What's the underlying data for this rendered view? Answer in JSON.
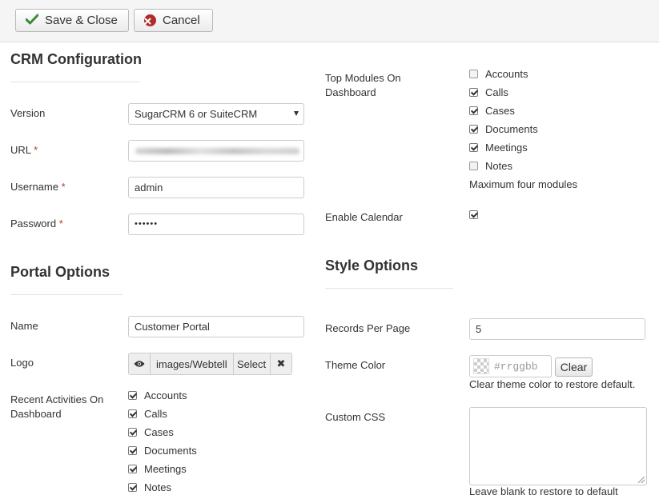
{
  "toolbar": {
    "save_close_label": "Save & Close",
    "cancel_label": "Cancel"
  },
  "crm": {
    "heading": "CRM Configuration",
    "version_label": "Version",
    "version_value": "SugarCRM 6 or SuiteCRM",
    "url_label": "URL",
    "username_label": "Username",
    "username_value": "admin",
    "password_label": "Password",
    "password_value": "••••••",
    "required_mark": "*"
  },
  "portal": {
    "heading": "Portal Options",
    "name_label": "Name",
    "name_value": "Customer Portal",
    "logo_label": "Logo",
    "logo_value": "images/Webtell",
    "logo_select_label": "Select",
    "logo_clear_label": "✖",
    "recent_label": "Recent Activities On Dashboard",
    "recent_modules": [
      {
        "label": "Accounts",
        "checked": true
      },
      {
        "label": "Calls",
        "checked": true
      },
      {
        "label": "Cases",
        "checked": true
      },
      {
        "label": "Documents",
        "checked": true
      },
      {
        "label": "Meetings",
        "checked": true
      },
      {
        "label": "Notes",
        "checked": true
      }
    ]
  },
  "dashboard": {
    "top_modules_label": "Top Modules On Dashboard",
    "top_modules": [
      {
        "label": "Accounts",
        "checked": false
      },
      {
        "label": "Calls",
        "checked": true
      },
      {
        "label": "Cases",
        "checked": true
      },
      {
        "label": "Documents",
        "checked": true
      },
      {
        "label": "Meetings",
        "checked": true
      },
      {
        "label": "Notes",
        "checked": false
      }
    ],
    "max_note": "Maximum four modules",
    "calendar_label": "Enable Calendar",
    "calendar_checked": true
  },
  "style": {
    "heading": "Style Options",
    "records_label": "Records Per Page",
    "records_value": "5",
    "theme_label": "Theme Color",
    "theme_placeholder": "#rrggbb",
    "clear_label": "Clear",
    "theme_note": "Clear theme color to restore default.",
    "css_label": "Custom CSS",
    "css_note": "Leave blank to restore to default"
  },
  "colors": {
    "save_check": "#3a8a3a",
    "cancel_icon": "#b22b2b",
    "required": "#bd362f"
  }
}
